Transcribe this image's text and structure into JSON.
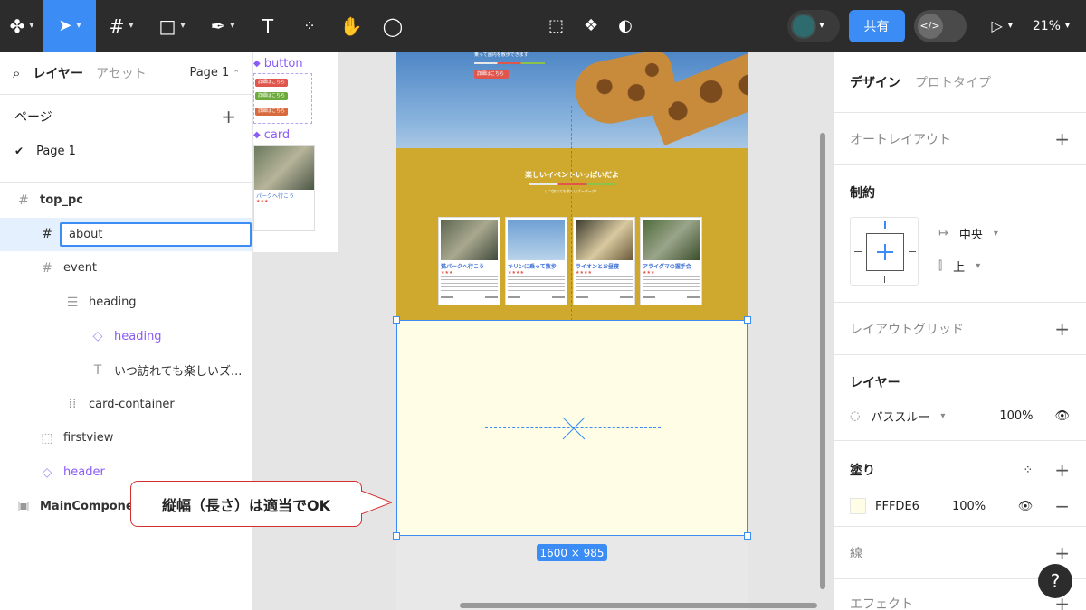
{
  "toolbar": {
    "zoom": "21%",
    "share_label": "共有",
    "dev_mode_label": "</>",
    "menu_icons": [
      "figma-menu-icon",
      "move-tool-icon",
      "frame-tool-icon",
      "shape-tool-icon",
      "pen-tool-icon",
      "text-tool-icon",
      "resources-icon",
      "hand-tool-icon",
      "comment-tool-icon"
    ],
    "center_icons": [
      "crop-icon",
      "component-icon",
      "contrast-icon"
    ]
  },
  "left_panel": {
    "tab_layers": "レイヤー",
    "tab_assets": "アセット",
    "page_select": "Page 1",
    "pages_title": "ページ",
    "pages": [
      {
        "label": "Page 1",
        "current": true
      }
    ],
    "layers": [
      {
        "label": "top_pc",
        "icon": "frame-icon",
        "depth": 0,
        "bold": true
      },
      {
        "label": "about",
        "icon": "frame-icon",
        "depth": 1,
        "selected": true,
        "editing": true
      },
      {
        "label": "event",
        "icon": "frame-icon",
        "depth": 1
      },
      {
        "label": "heading",
        "icon": "auto-layout-icon",
        "depth": 2
      },
      {
        "label": "heading",
        "icon": "instance-icon",
        "depth": 3,
        "component": true
      },
      {
        "label": "いつ訪れても楽しいズ...",
        "icon": "text-icon",
        "depth": 3
      },
      {
        "label": "card-container",
        "icon": "grid-layout-icon",
        "depth": 2
      },
      {
        "label": "firstview",
        "icon": "section-icon",
        "depth": 1
      },
      {
        "label": "header",
        "icon": "instance-icon",
        "depth": 1,
        "component": true
      },
      {
        "label": "MainComponen",
        "icon": "page-frame-icon",
        "depth": 0,
        "bold": true
      }
    ]
  },
  "canvas": {
    "components": {
      "button_label": "button",
      "card_label": "card",
      "button_texts": [
        "詳細はこちら",
        "詳細はこちら",
        "詳細はこちら"
      ],
      "card_title": "パークへ行こう",
      "card_stars": "★★★"
    },
    "hero": {
      "subtitle": "乗って園内を散歩できます",
      "button": "詳細はこちら"
    },
    "event": {
      "title": "楽しいイベントいっぱいだよ",
      "subtitle": "いつ訪れても楽しいズーパーク！",
      "cards": [
        {
          "title": "猫パークへ行こう",
          "stars": "★★★",
          "color": "#8a8a6a"
        },
        {
          "title": "キリンに乗って散歩",
          "stars": "★★★★",
          "color": "#7aa7d6"
        },
        {
          "title": "ライオンとお昼寝",
          "stars": "★★★★",
          "color": "#c9b38a"
        },
        {
          "title": "アライグマの握手会",
          "stars": "★★★",
          "color": "#5f7d4a"
        }
      ]
    },
    "size_badge": "1600 × 985",
    "callout": "縦幅（長さ）は適当でOK"
  },
  "right_panel": {
    "tab_design": "デザイン",
    "tab_prototype": "プロトタイプ",
    "auto_layout": "オートレイアウト",
    "constraints_title": "制約",
    "constraint_h": "中央",
    "constraint_v": "上",
    "layout_grid": "レイアウトグリッド",
    "layer_title": "レイヤー",
    "blend_mode": "パススルー",
    "layer_opacity": "100%",
    "fill_title": "塗り",
    "fill_hex": "FFFDE6",
    "fill_opacity": "100%",
    "stroke_title": "線",
    "effects_title": "エフェクト",
    "help": "?"
  }
}
